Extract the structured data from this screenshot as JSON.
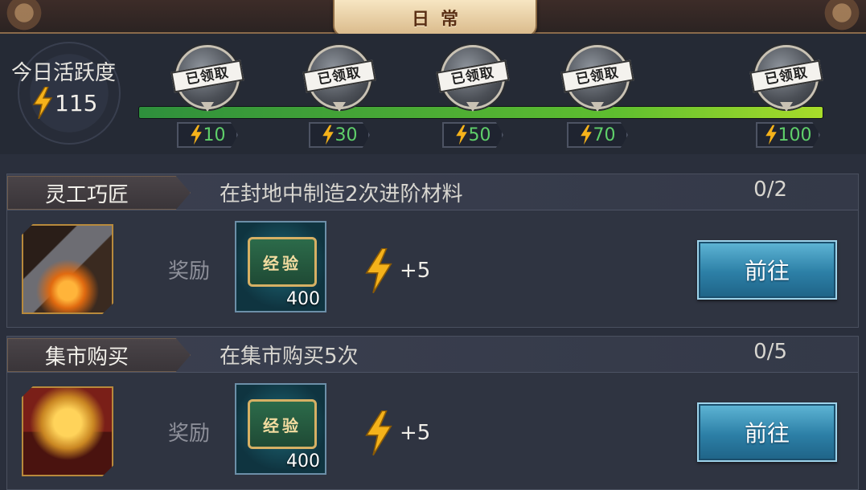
{
  "panel": {
    "title": "日常"
  },
  "activity": {
    "label": "今日活跃度",
    "value": "115",
    "progress_fraction": 1.0,
    "milestones": [
      {
        "points": "10",
        "status": "已领取"
      },
      {
        "points": "30",
        "status": "已领取"
      },
      {
        "points": "50",
        "status": "已领取"
      },
      {
        "points": "70",
        "status": "已领取"
      },
      {
        "points": "100",
        "status": "已领取"
      }
    ]
  },
  "tasks": [
    {
      "category": "灵工巧匠",
      "description": "在封地中制造2次进阶材料",
      "progress": "0/2",
      "reward_label": "奖励",
      "reward_item_name": "经验",
      "reward_item_count": "400",
      "reward_points": "+5",
      "button_label": "前往",
      "icon": "hammer-icon"
    },
    {
      "category": "集市购买",
      "description": "在集市购买5次",
      "progress": "0/5",
      "reward_label": "奖励",
      "reward_item_name": "经验",
      "reward_item_count": "400",
      "reward_points": "+5",
      "button_label": "前往",
      "icon": "treasure-chest-icon"
    }
  ],
  "colors": {
    "progress_green": "#4fb33a",
    "points_green": "#5fd06a",
    "button_blue": "#2c7fa6",
    "bolt_gold": "#f5b21a"
  }
}
